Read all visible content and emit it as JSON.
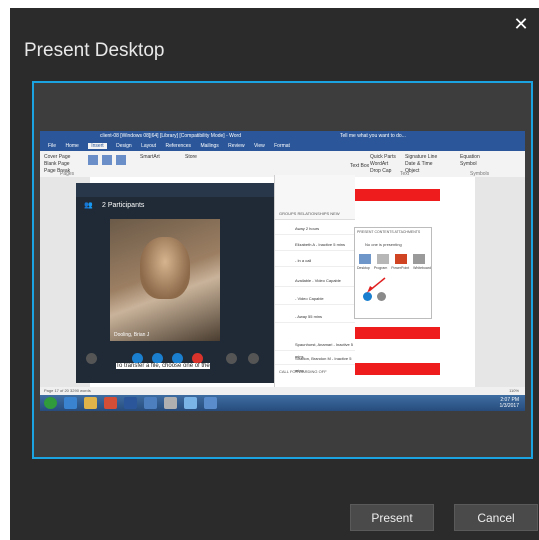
{
  "dialog": {
    "title": "Present Desktop",
    "close_icon": "close-icon",
    "present_label": "Present",
    "cancel_label": "Cancel"
  },
  "preview": {
    "word": {
      "title": "client-08 [Windows 08]|64] [Library] [Compatibility Mode] - Word",
      "tabs": [
        "File",
        "Home",
        "Insert",
        "Design",
        "Layout",
        "References",
        "Mailings",
        "Review",
        "View",
        "Format"
      ],
      "tell_me": "Tell me what you want to do...",
      "ribbon_items": [
        "Cover Page",
        "Blank Page",
        "Page Break",
        "SmartArt",
        "Store",
        "Quick Parts",
        "Signature Line",
        "Equation",
        "Symbol",
        "WordArt",
        "Date & Time",
        "Drop Cap",
        "Object",
        "Text Box"
      ],
      "group_labels": [
        "Pages",
        "Text",
        "Symbols"
      ],
      "status": "Page 17 of 20   3290 words",
      "zoom": "110%",
      "transfer_text": "To transfer a file, choose one of the"
    },
    "call": {
      "participants": "2 Participants",
      "caller_name": "Dooling, Brian J"
    },
    "contacts": [
      "Away 2 hours",
      "Elizabeth A - Inactive 5 mins",
      "- In a call",
      "Available - Video Capable",
      "- Video Capable",
      "- Away 55 mins",
      "Spaunhorst, Anamari - Inactive 5 mins",
      "Stratton, Brandon M - Inactive 5 mins"
    ],
    "contacts_header": "GROUPS  RELATIONSHIPS  NEW",
    "call_forwarding": "CALL FORWARDING OFF",
    "present_popup": {
      "tabs": [
        "PRESENT",
        "CONTENTS",
        "ATTACHMENTS"
      ],
      "not_presenting": "No one is presenting",
      "items": [
        "Desktop",
        "Program",
        "PowerPoint",
        "Whiteboard"
      ]
    },
    "clock": {
      "time": "2:07 PM",
      "date": "1/3/2017"
    }
  }
}
